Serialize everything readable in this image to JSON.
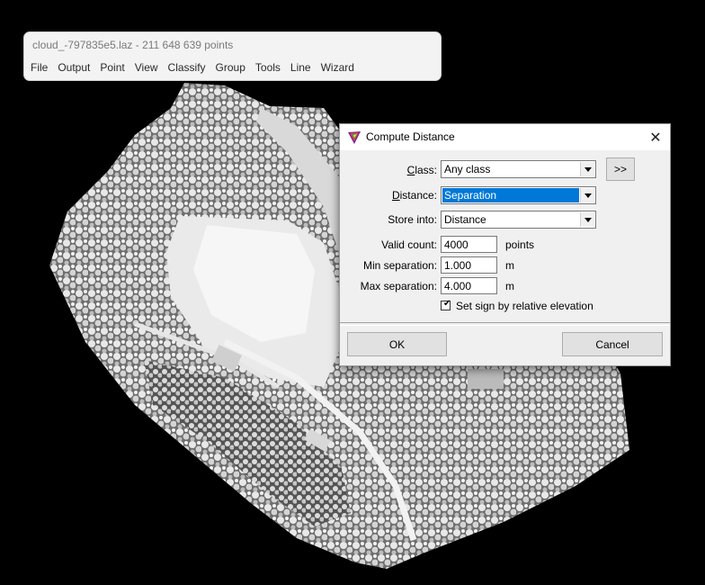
{
  "main_window": {
    "title": "cloud_-797835e5.laz - 211 648 639 points",
    "menu": [
      "File",
      "Output",
      "Point",
      "View",
      "Classify",
      "Group",
      "Tools",
      "Line",
      "Wizard"
    ]
  },
  "dialog": {
    "title": "Compute Distance",
    "class": {
      "label_first": "C",
      "label_rest": "lass:",
      "value": "Any class"
    },
    "more_button": ">>",
    "distance": {
      "label_first": "D",
      "label_rest": "istance:",
      "value": "Separation"
    },
    "store_into": {
      "label": "Store into:",
      "value": "Distance"
    },
    "valid_count": {
      "label": "Valid count:",
      "value": "4000",
      "unit": "points"
    },
    "min_separation": {
      "label": "Min separation:",
      "value": "1.000",
      "unit": "m"
    },
    "max_separation": {
      "label": "Max separation:",
      "value": "4.000",
      "unit": "m"
    },
    "checkbox": {
      "label": "Set sign by relative elevation",
      "checked": true,
      "mark": "✔"
    },
    "ok_label": "OK",
    "cancel_label": "Cancel",
    "close_glyph": "✕"
  },
  "colors": {
    "selection": "#0078d7",
    "background": "#000000"
  }
}
